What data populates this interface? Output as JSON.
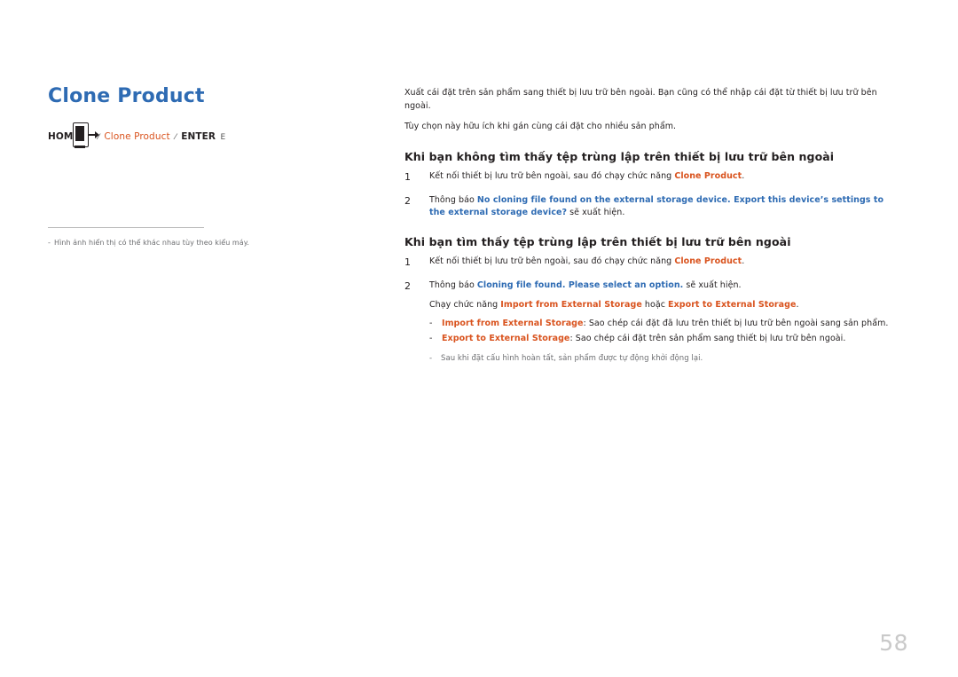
{
  "title": {
    "full": "Clone Product",
    "word1": "Clone",
    "word2": "Product"
  },
  "breadcrumb": {
    "home": "HOME",
    "sym1": "⌃",
    "quote_open": "⁄",
    "item": "Clone Product",
    "quote_close": "⁄",
    "enter": "ENTER",
    "sym2": "E"
  },
  "footnote": {
    "dash": "-",
    "text": "Hình ảnh hiển thị có thể khác nhau tùy theo kiểu máy."
  },
  "intro": {
    "p1": "Xuất cái đặt trên sản phẩm sang thiết bị lưu trữ bên ngoài. Bạn cũng có thể nhập cái đặt từ thiết bị lưu trữ bên ngoài.",
    "p2": "Tùy chọn này hữu ích khi gán cùng cái đặt cho nhiều sản phẩm."
  },
  "section_not_found": {
    "heading": "Khi bạn không tìm thấy tệp trùng lập trên thiết bị lưu trữ bên ngoài",
    "step1_num": "1",
    "step1_text_a": "Kết nối thiết bị lưu trữ bên ngoài, sau đó chạy chức năng ",
    "step1_link": "Clone Product",
    "step1_text_b": ".",
    "step2_num": "2",
    "step2_text_a": "Thông báo ",
    "step2_link": "No cloning file found on the external storage device. Export this device’s settings to the external storage device?",
    "step2_text_b": " sẽ xuất hiện."
  },
  "section_found": {
    "heading": "Khi bạn tìm thấy tệp trùng lập trên thiết bị lưu trữ bên ngoài",
    "step1_num": "1",
    "step1_text_a": "Kết nối thiết bị lưu trữ bên ngoài, sau đó chạy chức năng ",
    "step1_link": "Clone Product",
    "step1_text_b": ".",
    "step2_num": "2",
    "step2_text_a": "Thông báo ",
    "step2_link": "Cloning file found. Please select an option.",
    "step2_text_b": " sẽ xuất hiện.",
    "choice_text_a": "Chạy chức năng ",
    "choice_link1": "Import from External Storage",
    "choice_text_b": " hoặc ",
    "choice_link2": "Export to External Storage",
    "choice_text_c": ".",
    "bullet1_dash": "-",
    "bullet1_link": "Import from External Storage",
    "bullet1_text": ": Sao chép cái đặt đã lưu trên thiết bị lưu trữ bên ngoài sang sản phẩm.",
    "bullet2_dash": "-",
    "bullet2_link": "Export to External Storage",
    "bullet2_text": ": Sao chép cái đặt trên sản phẩm sang thiết bị lưu trữ bên ngoài.",
    "note_dash": "-",
    "note_text": "Sau khi đặt cấu hình hoàn tất, sản phẩm được tự động khởi động lại."
  },
  "page_number": "58"
}
